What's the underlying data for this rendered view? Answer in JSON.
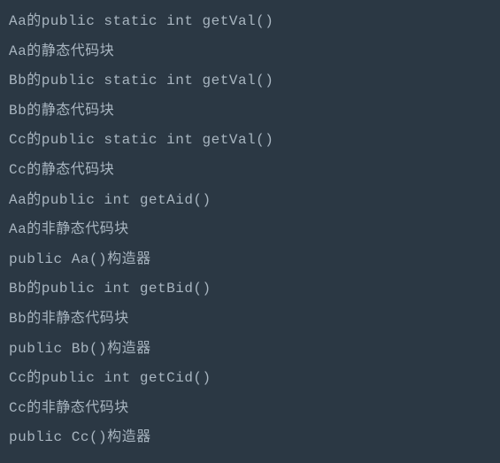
{
  "console": {
    "lines": [
      "Aa的public static int getVal()",
      "Aa的静态代码块",
      "Bb的public static int getVal()",
      "Bb的静态代码块",
      "Cc的public static int getVal()",
      "Cc的静态代码块",
      "Aa的public int getAid()",
      "Aa的非静态代码块",
      "public Aa()构造器",
      "Bb的public int getBid()",
      "Bb的非静态代码块",
      "public Bb()构造器",
      "Cc的public int getCid()",
      "Cc的非静态代码块",
      "public Cc()构造器"
    ]
  }
}
